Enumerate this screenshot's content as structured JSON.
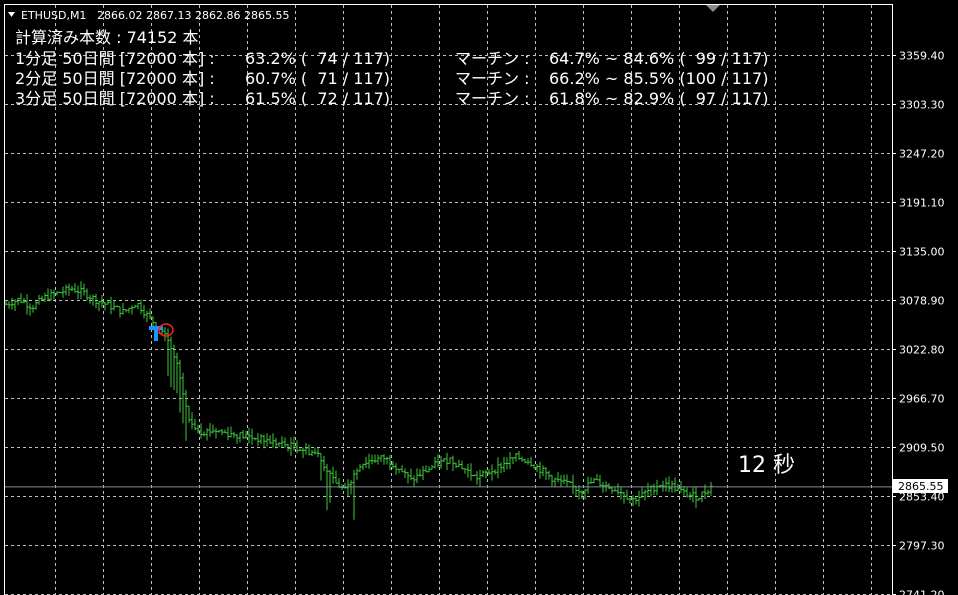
{
  "header": {
    "symbol": "ETHUSD,M1",
    "ohlc": "2866.02 2867.13 2862.86 2865.55"
  },
  "stats": {
    "computed_bars": "計算済み本数 : 74152 本",
    "rows": [
      {
        "label": "1分足 50日間 [72000 本] :",
        "rate": "63.2% (  74 / 117)",
        "martin_label": "マーチン :",
        "martin": "64.7% ~ 84.6% (  99 / 117)"
      },
      {
        "label": "2分足 50日間 [72000 本] :",
        "rate": "60.7% (  71 / 117)",
        "martin_label": "マーチン :",
        "martin": "66.2% ~ 85.5% (100 / 117)"
      },
      {
        "label": "3分足 50日間 [72000 本] :",
        "rate": "61.5% (  72 / 117)",
        "martin_label": "マーチン :",
        "martin": "61.8% ~ 82.9% (  97 / 117)"
      }
    ]
  },
  "timer": "12 秒",
  "current_price": "2865.55",
  "colors": {
    "background": "#000000",
    "grid": "#c0c0c0",
    "bars": "#3cc83c",
    "price_line": "#7f8c99",
    "buy_arrow": "#1e90ff",
    "signal_circle": "#ff2020"
  },
  "chart_data": {
    "type": "ohlc",
    "title": "ETHUSD,M1",
    "ylim": [
      2741.2,
      3400
    ],
    "y_ticks": [
      "3359.40",
      "3303.30",
      "3247.20",
      "3191.10",
      "3135.00",
      "3078.90",
      "3022.80",
      "2966.70",
      "2909.50",
      "2853.40",
      "2797.30",
      "2741.20"
    ],
    "current_price": 2865.55,
    "grid": true,
    "closes_approx": [
      3074,
      3080,
      3071,
      3082,
      3087,
      3092,
      3087,
      3078,
      3072,
      3065,
      3076,
      3058,
      3043,
      3010,
      2940,
      2928,
      2930,
      2926,
      2924,
      2921,
      2918,
      2914,
      2911,
      2907,
      2902,
      2872,
      2860,
      2890,
      2896,
      2898,
      2888,
      2872,
      2882,
      2891,
      2897,
      2887,
      2875,
      2882,
      2890,
      2899,
      2895,
      2884,
      2873,
      2868,
      2860,
      2872,
      2866,
      2860,
      2850,
      2858,
      2868,
      2866,
      2857,
      2853,
      2865
    ]
  }
}
